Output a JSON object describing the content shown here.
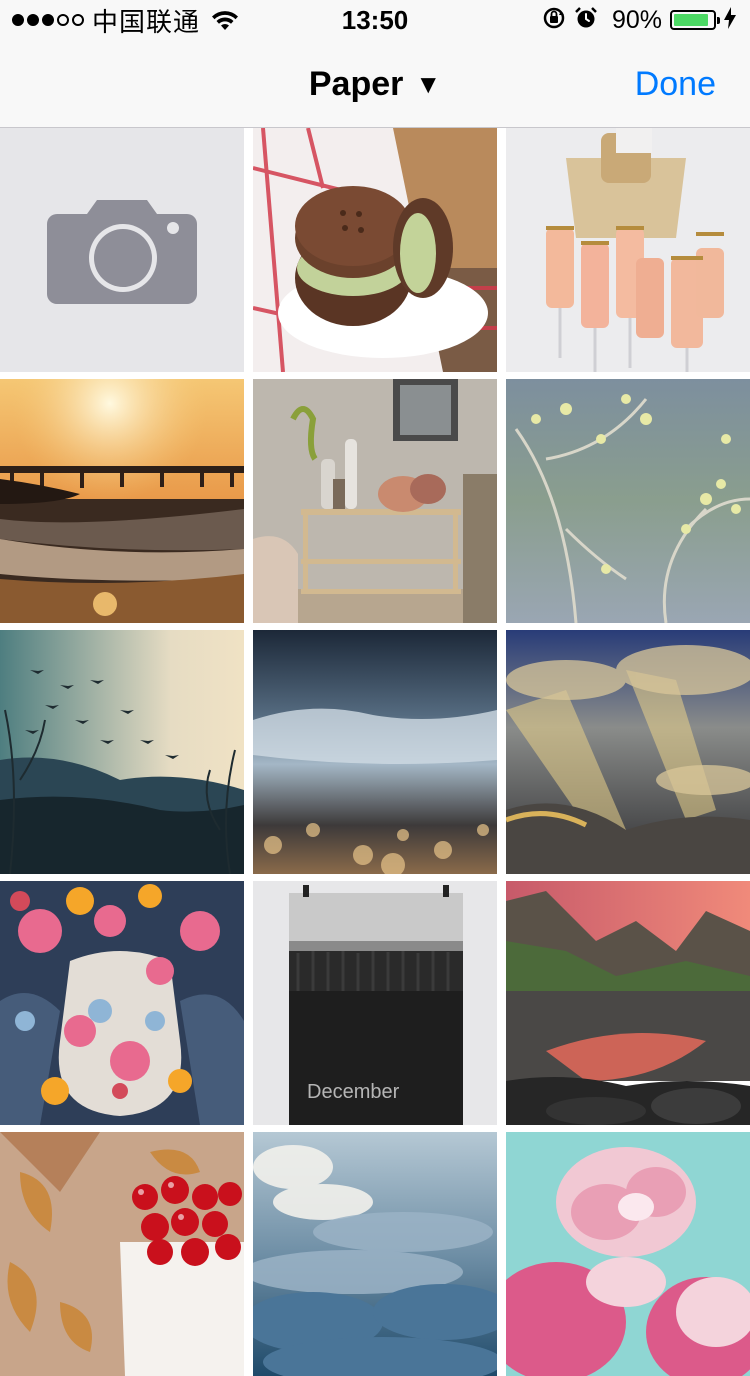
{
  "status_bar": {
    "carrier": "中国联通",
    "time": "13:50",
    "battery_percent": "90%",
    "battery_level": 0.9,
    "signal_bars_filled": 3,
    "signal_bars_total": 5
  },
  "nav": {
    "title": "Paper",
    "caret": "▼",
    "done_label": "Done",
    "accent_color": "#007aff"
  },
  "grid": {
    "camera_tile_icon": "camera-icon",
    "december_text": "December"
  }
}
